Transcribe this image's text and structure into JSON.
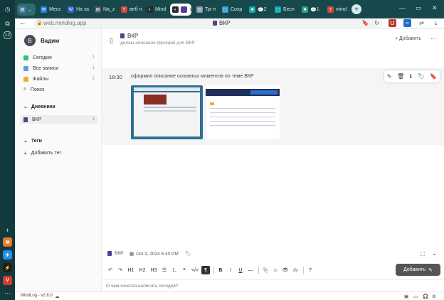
{
  "browser": {
    "tabs": [
      {
        "label": "",
        "color": "#5b7aa6",
        "glyph": "▤"
      },
      {
        "label": "Месс",
        "color": "#2d7fe0",
        "glyph": "✉"
      },
      {
        "label": "На за",
        "color": "#2d66c8",
        "glyph": "W"
      },
      {
        "label": "Na_z",
        "color": "#4d5a66",
        "glyph": "▤"
      },
      {
        "label": "веб п",
        "color": "#d6443a",
        "glyph": "Y"
      },
      {
        "label": "Mind",
        "color": "#2a2a2a",
        "glyph": "◐"
      },
      {
        "label": "Трі п",
        "color": "#8899aa",
        "glyph": "◎"
      },
      {
        "label": "Сохр",
        "color": "#3fa0d5",
        "glyph": "⬚"
      },
      {
        "label": "2",
        "color": "#18a8a8",
        "glyph": "■"
      },
      {
        "label": "Бесп",
        "color": "#1aa6b0",
        "glyph": "⬚"
      },
      {
        "label": "1",
        "color": "#2aa67e",
        "glyph": "■"
      },
      {
        "label": "mind",
        "color": "#d6443a",
        "glyph": "Y"
      }
    ],
    "active_tab_count_badge": "",
    "url": "web.mindlog.app",
    "page_title": "ВКР"
  },
  "sidebar": {
    "user_initial": "В",
    "user_name": "Вадим",
    "nav": [
      {
        "label": "Сегодня",
        "count": "1",
        "color": "#3dbb7a"
      },
      {
        "label": "Все записи",
        "count": "1",
        "color": "#5aa0e6"
      },
      {
        "label": "Файлы",
        "count": "2",
        "color": "#e6b42a"
      },
      {
        "label": "Поиск",
        "count": "",
        "color": ""
      }
    ],
    "diaries_header": "Дневники",
    "diaries": [
      {
        "label": "ВКР",
        "count": "1"
      }
    ],
    "tags_header": "Теги",
    "add_tag_label": "Добавить тег"
  },
  "main": {
    "title": "ВКР",
    "subtitle": "делаю описание функций для ВКР",
    "add_label": "Добавить",
    "entry": {
      "time": "18:30",
      "text": "оформил описание основных моментов по теме ВКР"
    }
  },
  "editor": {
    "notebook": "ВКР",
    "date": "Oct 3, 2024 6:40 PM",
    "heading_buttons": [
      "H1",
      "H2",
      "H3"
    ],
    "submit_label": "Добавить",
    "placeholder": "О чем хочется написать сегодня?"
  },
  "statusbar": {
    "app_version": "MindLog - v2.8.0"
  }
}
